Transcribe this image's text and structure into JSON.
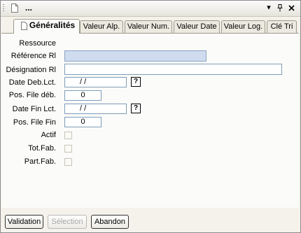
{
  "window": {
    "title": "..."
  },
  "titlebar": {
    "dropdown_glyph": "▾",
    "pin_glyph": "ᚴ",
    "close_glyph": "✕"
  },
  "tabs": [
    {
      "label": "Généralités",
      "active": true
    },
    {
      "label": "Valeur Alp."
    },
    {
      "label": "Valeur Num."
    },
    {
      "label": "Valeur Date"
    },
    {
      "label": "Valeur Log."
    },
    {
      "label": "Clé Tri"
    }
  ],
  "form": {
    "ressource_label": "Ressource",
    "reference_label": "Référence Rl",
    "reference_value": "",
    "designation_label": "Désignation Rl",
    "designation_value": "",
    "date_deb_label": "Date Deb.Lct.",
    "date_deb_value": "/    /",
    "pos_file_deb_label": "Pos. File déb.",
    "pos_file_deb_value": "0",
    "date_fin_label": "Date Fin Lct.",
    "date_fin_value": "/    /",
    "pos_file_fin_label": "Pos. File Fin",
    "pos_file_fin_value": "0",
    "actif_label": "Actif",
    "totfab_label": "Tot.Fab.",
    "partfab_label": "Part.Fab.",
    "help_glyph": "?"
  },
  "buttons": {
    "validation": "Validation",
    "selection": "Sélection",
    "abandon": "Abandon"
  },
  "colors": {
    "accent_field": "#cfdcef",
    "window_bg": "#f4f2ea"
  }
}
